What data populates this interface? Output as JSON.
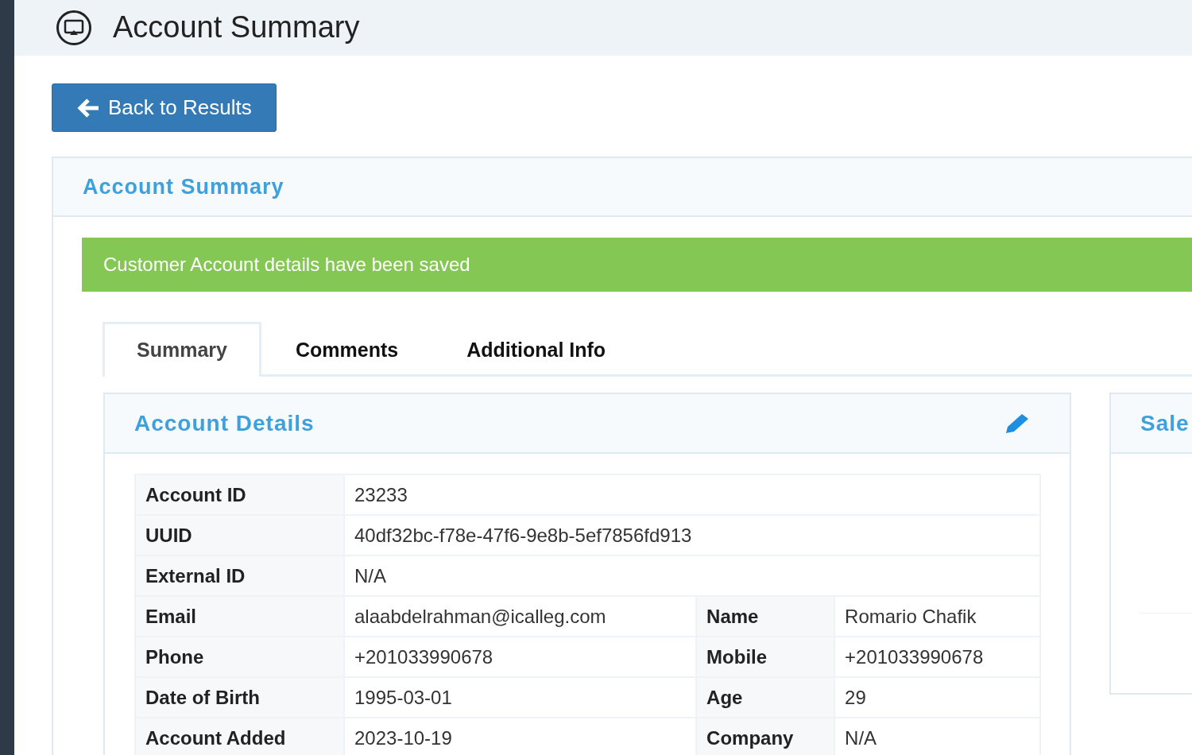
{
  "page_title": "Account Summary",
  "back_button": "Back to Results",
  "panel_title": "Account Summary",
  "alert": {
    "kind": "success",
    "text": "Customer Account details have been saved"
  },
  "tabs": [
    {
      "label": "Summary",
      "selected": true
    },
    {
      "label": "Comments",
      "selected": false
    },
    {
      "label": "Additional Info",
      "selected": false
    }
  ],
  "account_details": {
    "title": "Account Details",
    "rows": [
      {
        "cells": [
          {
            "label": "Account ID",
            "value": "23233"
          }
        ]
      },
      {
        "cells": [
          {
            "label": "UUID",
            "value": "40df32bc-f78e-47f6-9e8b-5ef7856fd913"
          }
        ]
      },
      {
        "cells": [
          {
            "label": "External ID",
            "value": "N/A"
          }
        ]
      },
      {
        "cells": [
          {
            "label": "Email",
            "value": "alaabdelrahman@icalleg.com"
          },
          {
            "label": "Name",
            "value": "Romario Chafik"
          }
        ]
      },
      {
        "cells": [
          {
            "label": "Phone",
            "value": "+201033990678"
          },
          {
            "label": "Mobile",
            "value": "+201033990678"
          }
        ]
      },
      {
        "cells": [
          {
            "label": "Date of Birth",
            "value": "1995-03-01"
          },
          {
            "label": "Age",
            "value": "29"
          }
        ]
      },
      {
        "cells": [
          {
            "label": "Account Added",
            "value": "2023-10-19"
          },
          {
            "label": "Company",
            "value": "N/A"
          }
        ]
      }
    ]
  },
  "side_card": {
    "title": "Sale"
  }
}
